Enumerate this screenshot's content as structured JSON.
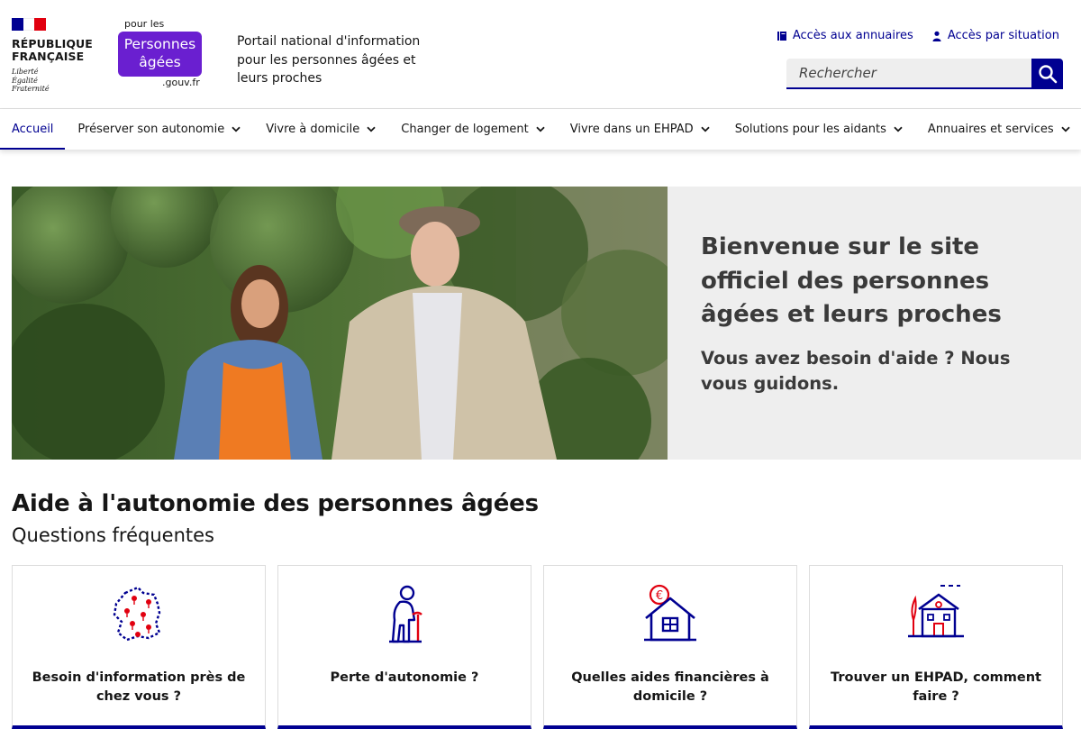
{
  "header": {
    "republic_name": "RÉPUBLIQUE FRANÇAISE",
    "motto": [
      "Liberté",
      "Égalité",
      "Fraternité"
    ],
    "flag_colors": [
      "#000091",
      "#ffffff",
      "#e1000f"
    ],
    "site_logo": {
      "pour_les": "pour les",
      "line1": "Personnes",
      "line2": "âgées",
      "domain": ".gouv.fr",
      "color": "#6a1fd0"
    },
    "tagline": "Portail national d'information pour les personnes âgées et leurs proches",
    "access_links": [
      {
        "label": "Accès aux annuaires",
        "icon": "book-icon"
      },
      {
        "label": "Accès par situation",
        "icon": "user-icon"
      }
    ],
    "search": {
      "placeholder": "Rechercher",
      "button_icon": "search-icon"
    }
  },
  "nav": {
    "items": [
      {
        "label": "Accueil",
        "active": true,
        "dropdown": false
      },
      {
        "label": "Préserver son autonomie",
        "active": false,
        "dropdown": true
      },
      {
        "label": "Vivre à domicile",
        "active": false,
        "dropdown": true
      },
      {
        "label": "Changer de logement",
        "active": false,
        "dropdown": true
      },
      {
        "label": "Vivre dans un EHPAD",
        "active": false,
        "dropdown": true
      },
      {
        "label": "Solutions pour les aidants",
        "active": false,
        "dropdown": true
      },
      {
        "label": "Annuaires et services",
        "active": false,
        "dropdown": true
      }
    ]
  },
  "hero": {
    "title": "Bienvenue sur le site officiel des personnes âgées et leurs proches",
    "subtitle": "Vous avez besoin d'aide ? Nous vous guidons."
  },
  "section": {
    "title": "Aide à l'autonomie des personnes âgées",
    "subtitle": "Questions fréquentes"
  },
  "cards": [
    {
      "label": "Besoin d'information près de chez vous ?",
      "icon": "france-map-icon"
    },
    {
      "label": "Perte d'autonomie ?",
      "icon": "elderly-person-cane-icon"
    },
    {
      "label": "Quelles aides financières à domicile ?",
      "icon": "house-euro-icon"
    },
    {
      "label": "Trouver un EHPAD, comment faire ?",
      "icon": "residence-building-icon"
    }
  ],
  "colors": {
    "primary": "#000091",
    "accent_red": "#e1000f",
    "panel_bg": "#eeeeee"
  }
}
